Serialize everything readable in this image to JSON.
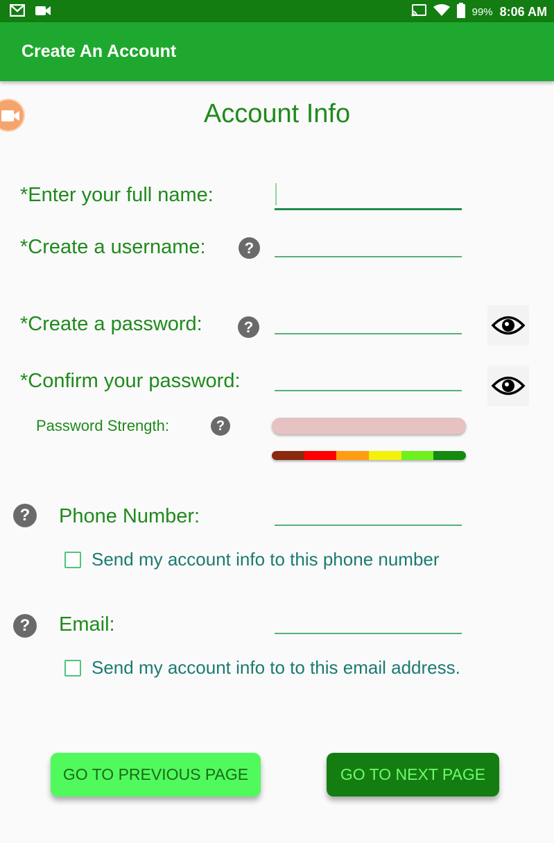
{
  "status_bar": {
    "icons": [
      "gmail-icon",
      "video-camera-icon",
      "cast-icon",
      "wifi-icon",
      "battery-icon"
    ],
    "battery": "99%",
    "time": "8:06 AM"
  },
  "app_bar": {
    "title": "Create An Account"
  },
  "page": {
    "title": "Account Info"
  },
  "form": {
    "full_name": {
      "label": "*Enter your full name:",
      "value": ""
    },
    "username": {
      "label": "*Create a username:",
      "value": ""
    },
    "password": {
      "label": "*Create a password:",
      "value": ""
    },
    "confirm_password": {
      "label": "*Confirm your password:",
      "value": ""
    },
    "strength": {
      "label": "Password Strength:",
      "level": 0,
      "scale_colors": [
        "#8b2a10",
        "#ff0000",
        "#ff9c10",
        "#f2f20c",
        "#70f01e",
        "#168a10"
      ]
    },
    "phone": {
      "label": "Phone Number:",
      "value": ""
    },
    "phone_checkbox": {
      "label": "Send my account info to this phone number",
      "checked": false
    },
    "email": {
      "label": "Email:",
      "value": ""
    },
    "email_checkbox": {
      "label": "Send my account info to to this email address.",
      "checked": false
    }
  },
  "help_icon_glyph": "?",
  "buttons": {
    "previous": "GO TO PREVIOUS PAGE",
    "next": "GO TO NEXT PAGE"
  },
  "colors": {
    "status_bar": "#137d12",
    "app_bar": "#1fa82f",
    "label_green": "#1f8a1c",
    "checkbox_text": "#1b7a72",
    "prev_button": "#50fa5c",
    "next_button": "#137d12"
  }
}
